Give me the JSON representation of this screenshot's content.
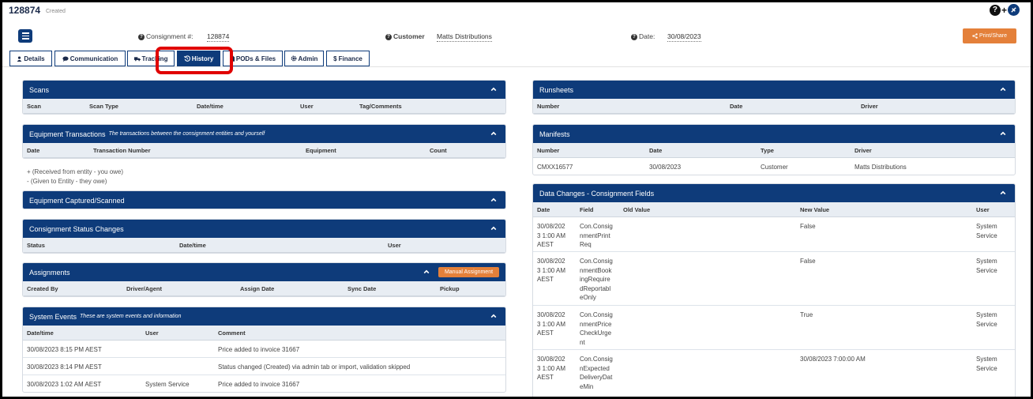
{
  "header": {
    "consignment_number": "128874",
    "status": "Created",
    "consignment_label": "Consignment #:",
    "consignment_value": "128874",
    "customer_label": "Customer",
    "customer_value": "Matts Distributions",
    "date_label": "Date:",
    "date_value": "30/08/2023",
    "print_share_label": "Print/Share"
  },
  "tabs": [
    {
      "label": "Details",
      "icon": "user-icon"
    },
    {
      "label": "Communication",
      "icon": "chat-icon"
    },
    {
      "label": "Tracking",
      "icon": "truck-icon"
    },
    {
      "label": "History",
      "icon": "history-icon",
      "active": true
    },
    {
      "label": "PODs & Files",
      "icon": "file-icon"
    },
    {
      "label": "Admin",
      "icon": "gear-icon"
    },
    {
      "label": "Finance",
      "icon": "dollar-icon"
    }
  ],
  "scans": {
    "title": "Scans",
    "columns": [
      "Scan",
      "Scan Type",
      "Date/time",
      "User",
      "Tag/Comments"
    ]
  },
  "equipment_transactions": {
    "title": "Equipment Transactions",
    "subtitle": "The transactions between the consignment entities and yourself",
    "columns": [
      "Date",
      "Transaction Number",
      "Equipment",
      "Count"
    ],
    "note_received": "+ (Received from entity - you owe)",
    "note_given": "- (Given to Entity - they owe)"
  },
  "equipment_captured": {
    "title": "Equipment Captured/Scanned"
  },
  "status_changes": {
    "title": "Consignment Status Changes",
    "columns": [
      "Status",
      "Date/time",
      "User"
    ]
  },
  "assignments": {
    "title": "Assignments",
    "manual_button": "Manual Assignment",
    "columns": [
      "Created By",
      "Driver/Agent",
      "Assign Date",
      "Sync Date",
      "Pickup"
    ]
  },
  "system_events": {
    "title": "System Events",
    "subtitle": "These are system events and information",
    "columns": [
      "Date/time",
      "User",
      "Comment"
    ],
    "rows": [
      {
        "datetime": "30/08/2023 8:15 PM AEST",
        "user": "",
        "comment": "Price added to invoice 31667"
      },
      {
        "datetime": "30/08/2023 8:14 PM AEST",
        "user": "",
        "comment": "Status changed (Created) via admin tab or import, validation skipped"
      },
      {
        "datetime": "30/08/2023 1:02 AM AEST",
        "user": "System Service",
        "comment": "Price added to invoice 31667"
      }
    ]
  },
  "runsheets": {
    "title": "Runsheets",
    "columns": [
      "Number",
      "Date",
      "Driver"
    ]
  },
  "manifests": {
    "title": "Manifests",
    "columns": [
      "Number",
      "Date",
      "Type",
      "Driver"
    ],
    "rows": [
      {
        "number": "CMXX16577",
        "date": "30/08/2023",
        "type": "Customer",
        "driver": "Matts Distributions"
      }
    ]
  },
  "data_changes": {
    "title": "Data Changes - Consignment Fields",
    "columns": [
      "Date",
      "Field",
      "Old Value",
      "New Value",
      "User"
    ],
    "rows": [
      {
        "date": "30/08/202\n3 1:00 AM\nAEST",
        "field": "Con.Consig\nnmentPrint\nReq",
        "old": "",
        "new": "False",
        "user": "System\nService"
      },
      {
        "date": "30/08/202\n3 1:00 AM\nAEST",
        "field": "Con.Consig\nnmentBook\ningRequire\ndReportabl\neOnly",
        "old": "",
        "new": "False",
        "user": "System\nService"
      },
      {
        "date": "30/08/202\n3 1:00 AM\nAEST",
        "field": "Con.Consig\nnmentPrice\nCheckUrge\nnt",
        "old": "",
        "new": "True",
        "user": "System\nService"
      },
      {
        "date": "30/08/202\n3 1:00 AM\nAEST",
        "field": "Con.Consig\nnExpected\nDeliveryDat\neMin",
        "old": "",
        "new": "30/08/2023 7:00:00 AM",
        "user": "System\nService"
      }
    ]
  },
  "colors": {
    "navy": "#0e3b7a",
    "orange": "#e4803a",
    "highlight_red": "#e00000"
  }
}
